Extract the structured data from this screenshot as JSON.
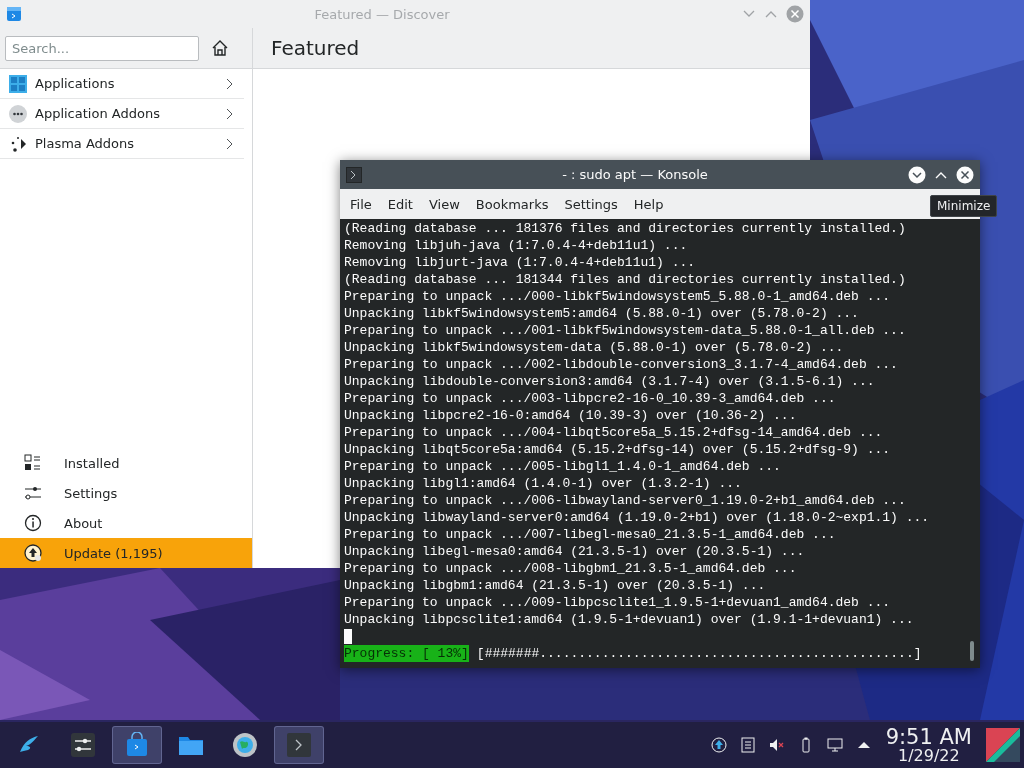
{
  "discover": {
    "title": "Featured — Discover",
    "search": {
      "placeholder": "Search..."
    },
    "page_title": "Featured",
    "categories": [
      {
        "label": "Applications",
        "kind": "grid"
      },
      {
        "label": "Application Addons",
        "kind": "dots"
      },
      {
        "label": "Plasma Addons",
        "kind": "plasma"
      }
    ],
    "bottom_items": [
      {
        "label": "Installed",
        "kind": "installed",
        "selected": false
      },
      {
        "label": "Settings",
        "kind": "settings",
        "selected": false
      },
      {
        "label": "About",
        "kind": "about",
        "selected": false
      },
      {
        "label": "Update (1,195)",
        "kind": "update",
        "selected": true
      }
    ]
  },
  "konsole": {
    "title": "- : sudo apt — Konsole",
    "menu": [
      "File",
      "Edit",
      "View",
      "Bookmarks",
      "Settings",
      "Help"
    ],
    "lines": [
      "(Reading database ... 181376 files and directories currently installed.)",
      "Removing libjuh-java (1:7.0.4-4+deb11u1) ...",
      "Removing libjurt-java (1:7.0.4-4+deb11u1) ...",
      "(Reading database ... 181344 files and directories currently installed.)",
      "Preparing to unpack .../000-libkf5windowsystem5_5.88.0-1_amd64.deb ...",
      "Unpacking libkf5windowsystem5:amd64 (5.88.0-1) over (5.78.0-2) ...",
      "Preparing to unpack .../001-libkf5windowsystem-data_5.88.0-1_all.deb ...",
      "Unpacking libkf5windowsystem-data (5.88.0-1) over (5.78.0-2) ...",
      "Preparing to unpack .../002-libdouble-conversion3_3.1.7-4_amd64.deb ...",
      "Unpacking libdouble-conversion3:amd64 (3.1.7-4) over (3.1.5-6.1) ...",
      "Preparing to unpack .../003-libpcre2-16-0_10.39-3_amd64.deb ...",
      "Unpacking libpcre2-16-0:amd64 (10.39-3) over (10.36-2) ...",
      "Preparing to unpack .../004-libqt5core5a_5.15.2+dfsg-14_amd64.deb ...",
      "Unpacking libqt5core5a:amd64 (5.15.2+dfsg-14) over (5.15.2+dfsg-9) ...",
      "Preparing to unpack .../005-libgl1_1.4.0-1_amd64.deb ...",
      "Unpacking libgl1:amd64 (1.4.0-1) over (1.3.2-1) ...",
      "Preparing to unpack .../006-libwayland-server0_1.19.0-2+b1_amd64.deb ...",
      "Unpacking libwayland-server0:amd64 (1.19.0-2+b1) over (1.18.0-2~exp1.1) ...",
      "Preparing to unpack .../007-libegl-mesa0_21.3.5-1_amd64.deb ...",
      "Unpacking libegl-mesa0:amd64 (21.3.5-1) over (20.3.5-1) ...",
      "Preparing to unpack .../008-libgbm1_21.3.5-1_amd64.deb ...",
      "Unpacking libgbm1:amd64 (21.3.5-1) over (20.3.5-1) ...",
      "Preparing to unpack .../009-libpcsclite1_1.9.5-1+devuan1_amd64.deb ...",
      "Unpacking libpcsclite1:amd64 (1.9.5-1+devuan1) over (1.9.1-1+devuan1) ..."
    ],
    "progress_label": "Progress: [ 13%]",
    "progress_bar": "[#######................................................]"
  },
  "tooltip": "Minimize",
  "taskbar": {
    "tasks": [
      {
        "kind": "launcher",
        "active": false
      },
      {
        "kind": "mixer",
        "active": false
      },
      {
        "kind": "store",
        "active": true
      },
      {
        "kind": "folder",
        "active": false
      },
      {
        "kind": "globe",
        "active": false
      },
      {
        "kind": "terminal",
        "active": true
      }
    ],
    "time": "9:51 AM",
    "date": "1/29/22"
  }
}
